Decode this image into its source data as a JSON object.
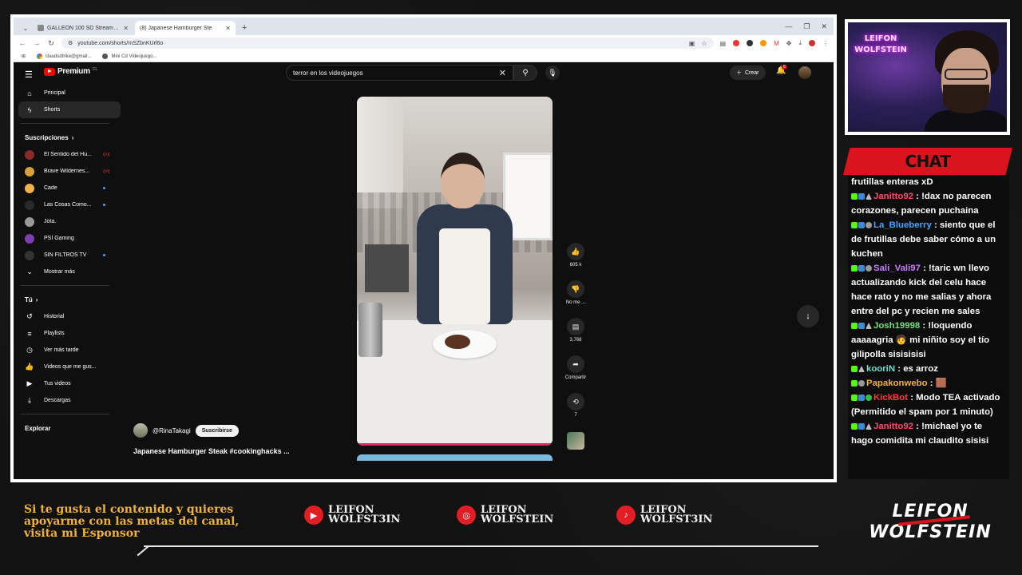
{
  "browser": {
    "tabs": [
      {
        "label": "GALLEON 100 SD Stream Deck",
        "active": false
      },
      {
        "label": "(8) Japanese Hamburger Ste",
        "active": true
      }
    ],
    "url": "youtube.com/shorts/mSZbnKUrl6o",
    "bookmarks": [
      "claudsdtrike@gmail...",
      "Mini Cd Videojuego..."
    ]
  },
  "youtube": {
    "logo": "Premium",
    "logo_region": "CL",
    "search_value": "terror en los videojuegos",
    "create_label": "Crear",
    "notif_count": "8",
    "nav": [
      {
        "label": "Principal",
        "icon": "home-icon",
        "active": false
      },
      {
        "label": "Shorts",
        "icon": "shorts-icon",
        "active": true
      }
    ],
    "subs_header": "Suscripciones",
    "subscriptions": [
      {
        "name": "El Sentido del Hu...",
        "badge": "live"
      },
      {
        "name": "Brave Wildernes...",
        "badge": "live"
      },
      {
        "name": "Cade",
        "badge": "dot"
      },
      {
        "name": "Las Cosas Como...",
        "badge": "dot"
      },
      {
        "name": "Jota.",
        "badge": ""
      },
      {
        "name": "PSI Gaming",
        "badge": ""
      },
      {
        "name": "SIN FILTROS TV",
        "badge": "dot"
      }
    ],
    "show_more": "Mostrar más",
    "you_header": "Tú",
    "you_items": [
      {
        "label": "Historial",
        "icon": "history-icon"
      },
      {
        "label": "Playlists",
        "icon": "playlists-icon"
      },
      {
        "label": "Ver más tarde",
        "icon": "clock-icon"
      },
      {
        "label": "Videos que me gus...",
        "icon": "like-icon"
      },
      {
        "label": "Tus videos",
        "icon": "your-videos-icon"
      },
      {
        "label": "Descargas",
        "icon": "download-icon"
      }
    ],
    "explore_header": "Explorar",
    "channel": "@RinaTakagi",
    "subscribe_label": "Suscribirse",
    "video_title": "Japanese Hamburger Steak #cookinghacks ...",
    "actions": {
      "likes": "605 k",
      "dislike": "No me ...",
      "comments": "3,768",
      "share": "Compartir",
      "remix": "7"
    }
  },
  "webcam": {
    "sign_line1": "LEIFON",
    "sign_line2": "WOLFSTEIN"
  },
  "chat": {
    "title": "CHAT",
    "messages": [
      {
        "user": "",
        "color": "#ffffff",
        "text": "frutillas enteras xD",
        "badges": []
      },
      {
        "user": "Janitto92",
        "color": "#ff4d6d",
        "text": "!dax no parecen corazones, parecen puchaina",
        "badges": [
          "k",
          "b",
          "s"
        ]
      },
      {
        "user": "La_Blueberry",
        "color": "#4aa3ff",
        "text": "siento que el de frutillas debe saber cómo a un kuchen",
        "badges": [
          "k",
          "b",
          "g"
        ]
      },
      {
        "user": "Sali_Vali97",
        "color": "#c77dff",
        "text": "!taric wn llevo actualizando kick del celu hace hace rato y no me salias y ahora entre del pc y recien me sales",
        "badges": [
          "k",
          "b",
          "g"
        ]
      },
      {
        "user": "Josh19998",
        "color": "#6fe07a",
        "text": "!loquendo aaaaagria 🧑 mi niñito soy el tío gilipolla sisisisisi",
        "badges": [
          "k",
          "b",
          "s"
        ]
      },
      {
        "user": "kooriN",
        "color": "#6fe0d0",
        "text": "es arroz",
        "badges": [
          "k",
          "s"
        ]
      },
      {
        "user": "Papakonwebo",
        "color": "#f0b23c",
        "text": "🟫",
        "badges": [
          "k",
          "g"
        ]
      },
      {
        "user": "KickBot",
        "color": "#ff3b3b",
        "text": "Modo TEA activado (Permitido el spam por 1 minuto)",
        "badges": [
          "k",
          "b",
          "v"
        ]
      },
      {
        "user": "Janitto92",
        "color": "#ff4d6d",
        "text": "!michael yo te hago comidita mi claudito sisisi",
        "badges": [
          "k",
          "b",
          "s"
        ]
      }
    ]
  },
  "footer": {
    "sponsor_text": "Si te gusta el contenido y quieres apoyarme con las metas del canal, visita mi Esponsor",
    "socials": [
      {
        "platform": "youtube-icon",
        "line1": "LEIFON",
        "line2": "WOLFST3IN"
      },
      {
        "platform": "instagram-icon",
        "line1": "LEIFON",
        "line2": "WOLFSTEIN"
      },
      {
        "platform": "tiktok-icon",
        "line1": "LEIFON",
        "line2": "WOLFST3IN"
      }
    ],
    "brand_line1": "LEIFON",
    "brand_line2": "WOLFSTEIN"
  },
  "colors": {
    "accent_red": "#d8141c",
    "footer_gold": "#f0b23c",
    "yt_bg": "#0f0f0f"
  }
}
